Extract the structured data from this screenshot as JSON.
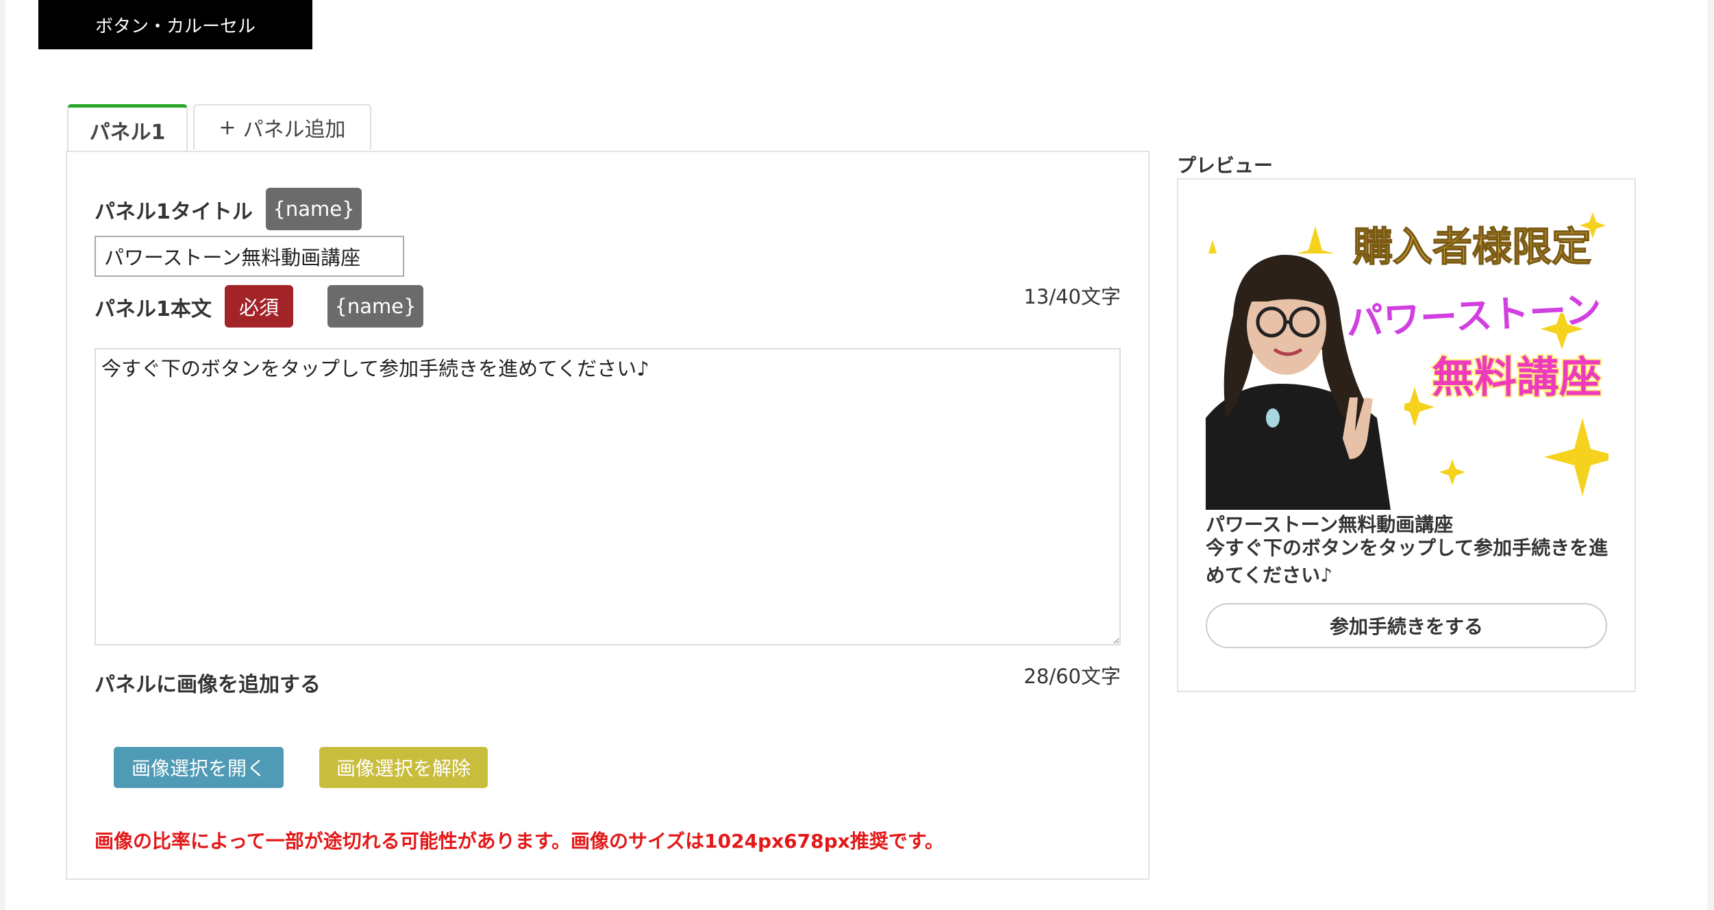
{
  "section_header": "ボタン・カルーセル",
  "tabs": {
    "active_label": "パネル1",
    "add_plus": "+",
    "add_label": "パネル追加"
  },
  "form": {
    "title_label": "パネル1タイトル",
    "name_tag": "{name}",
    "title_value": "パワーストーン無料動画講座",
    "title_counter": "13/40文字",
    "body_label": "パネル1本文",
    "required_tag": "必須",
    "body_value": "今すぐ下のボタンをタップして参加手続きを進めてください♪",
    "body_counter": "28/60文字",
    "image_label": "パネルに画像を追加する",
    "open_button": "画像選択を開く",
    "clear_button": "画像選択を解除",
    "warning": "画像の比率によって一部が途切れる可能性があります。画像のサイズは1024px678px推奨です。"
  },
  "preview": {
    "label": "プレビュー",
    "banner_line1": "購入者様限定",
    "banner_line2": "パワーストーン",
    "banner_line3": "無料講座",
    "title": "パワーストーン無料動画講座",
    "body": "今すぐ下のボタンをタップして参加手続きを進めてください♪",
    "button_label": "参加手続きをする"
  },
  "colors": {
    "active_tab_accent": "#2aa62a",
    "required_tag": "#a32428",
    "name_tag": "#6b6b6b",
    "open_button": "#4f9ab5",
    "clear_button": "#c9bd3e",
    "warning_text": "#e31818"
  }
}
